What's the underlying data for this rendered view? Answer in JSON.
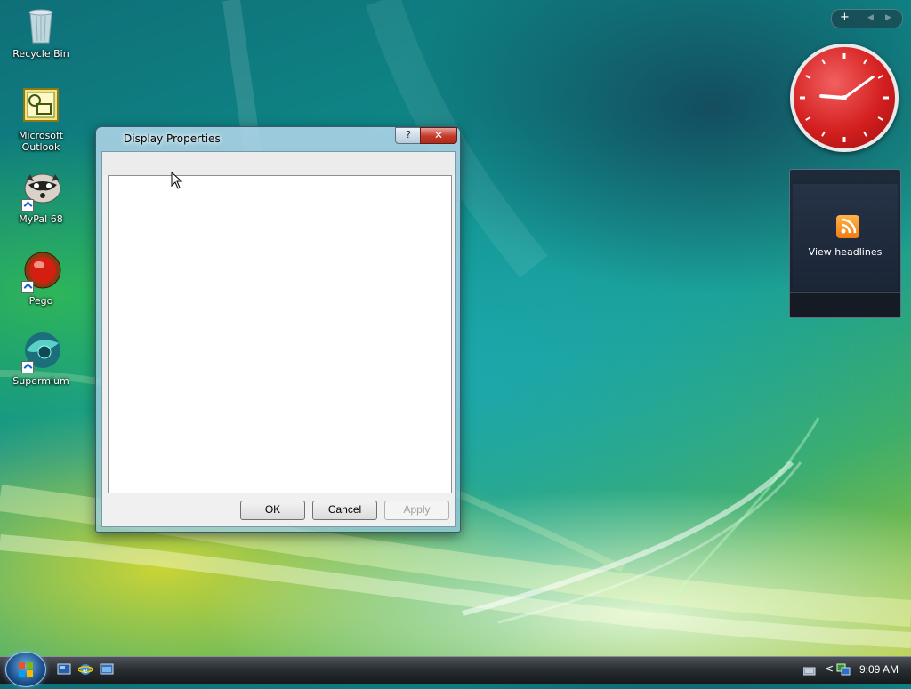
{
  "desktop": {
    "icons": [
      {
        "label": "Recycle Bin"
      },
      {
        "label": "Microsoft Outlook"
      },
      {
        "label": "MyPal 68"
      },
      {
        "label": "Pego"
      },
      {
        "label": "Supermium"
      }
    ]
  },
  "dialog": {
    "title": "Display Properties",
    "help_glyph": "?",
    "close_glyph": "✕",
    "buttons": {
      "ok": "OK",
      "cancel": "Cancel",
      "apply": "Apply"
    }
  },
  "gadgets": {
    "controls": {
      "add": "+",
      "prev": "◀",
      "next": "▶"
    },
    "clock": {
      "hour": 9,
      "minute": 9
    },
    "feed": {
      "label": "View headlines"
    }
  },
  "taskbar": {
    "time": "9:09 AM",
    "tray_expand": "<"
  },
  "colors": {
    "clock_face": "#d41f1f",
    "close_button": "#c2392a",
    "rss": "#f07d12"
  }
}
